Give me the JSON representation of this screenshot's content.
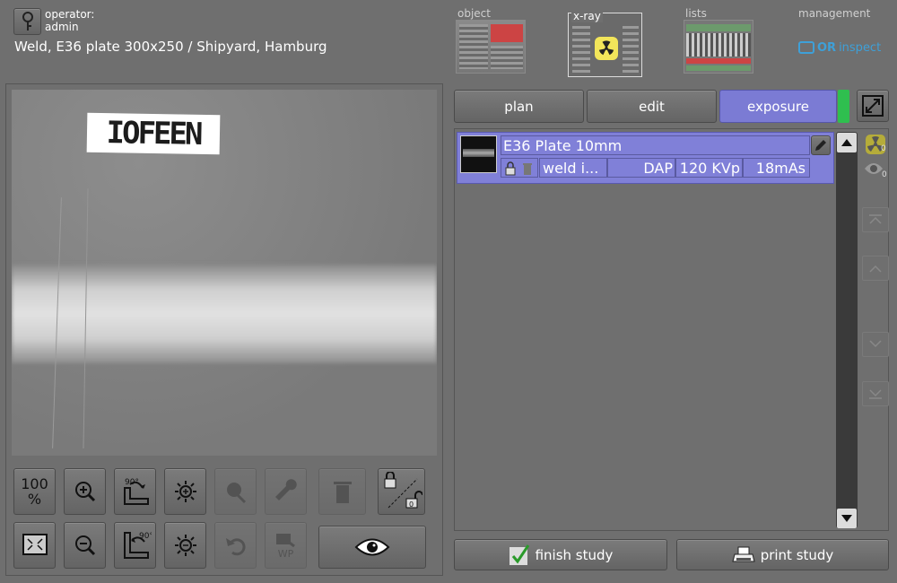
{
  "header": {
    "operator_label": "operator:",
    "operator_name": "admin",
    "study_title": "Weld, E36 plate 300x250 / Shipyard, Hamburg"
  },
  "nav_tabs": [
    {
      "label": "object"
    },
    {
      "label": "x-ray",
      "active": true
    },
    {
      "label": "lists"
    },
    {
      "label": "management"
    }
  ],
  "brand": {
    "part1": "OR",
    "part2": "inspect",
    "color": "#3ea0d8"
  },
  "image": {
    "marker_text": "IOFEEN"
  },
  "tools": {
    "zoom_100": "100\n%",
    "rotate_cw": "90°",
    "rotate_ccw": "90°",
    "wp": "WP",
    "lock_count": "0"
  },
  "mode_tabs": {
    "plan": "plan",
    "edit": "edit",
    "exposure": "exposure",
    "exposure_color": "#7b7bd4",
    "status_color": "#2fbf4f"
  },
  "exposure_item": {
    "title": "E36 Plate 10mm",
    "name": "weld i...",
    "dap": "DAP",
    "kvp": "120 KVp",
    "mas": "18mAs"
  },
  "side_badges": {
    "radiation_count": "0",
    "view_count": "0"
  },
  "footer": {
    "finish": "finish study",
    "print": "print study"
  }
}
